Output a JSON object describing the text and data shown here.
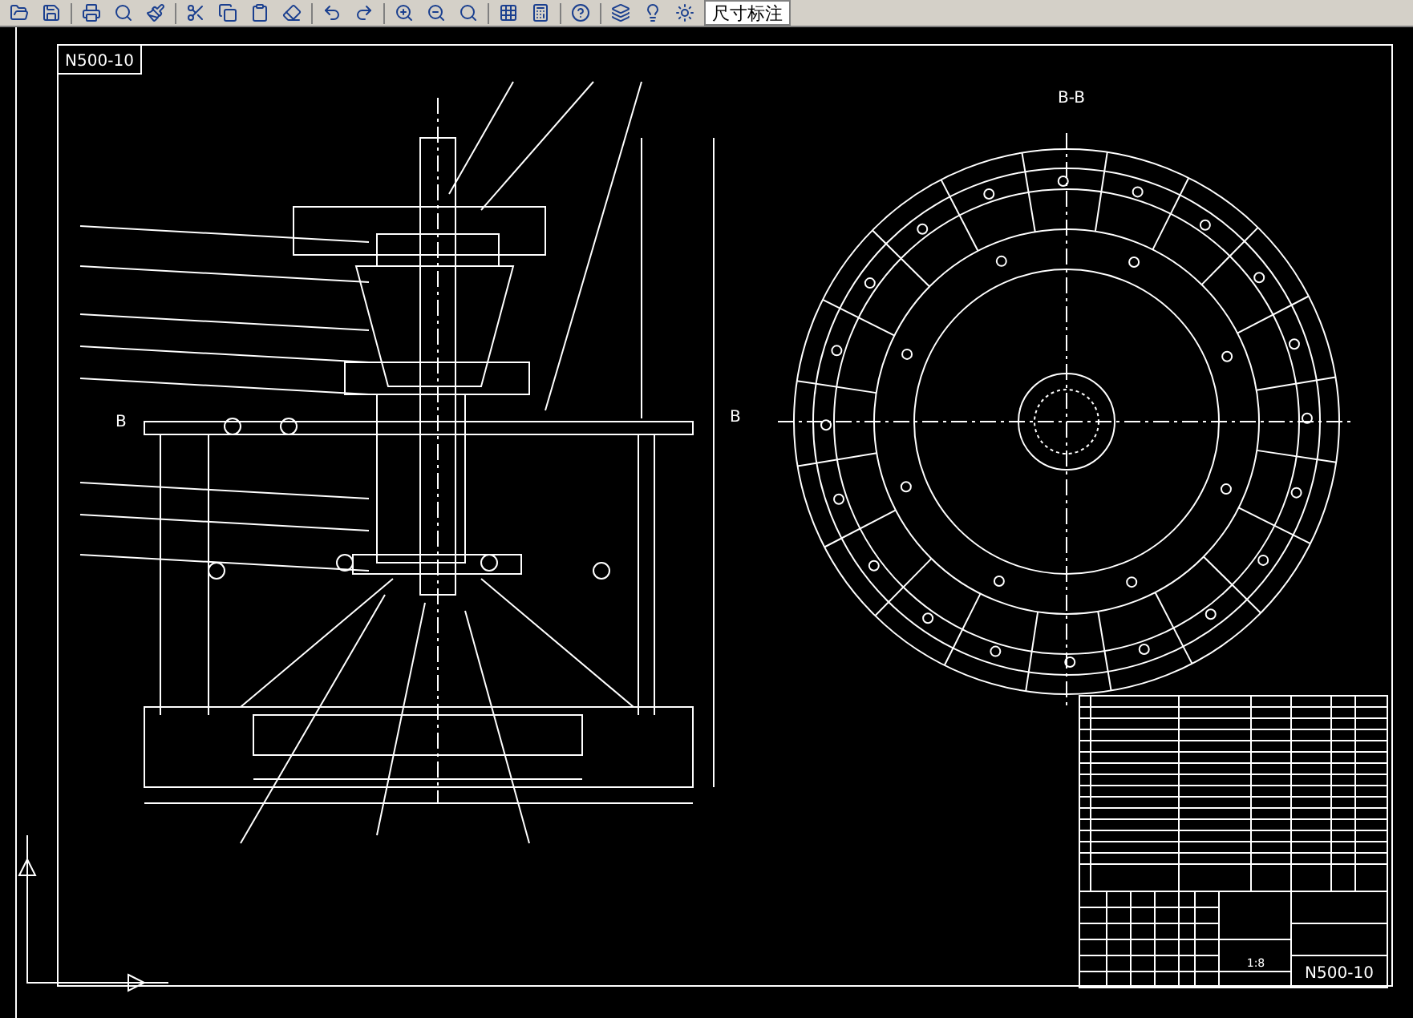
{
  "toolbar": {
    "layer_name": "尺寸标注"
  },
  "drawing": {
    "frame_label": "N500-10",
    "section_title": "B-B",
    "section_marks": [
      "B",
      "B"
    ]
  },
  "title_block": {
    "scale": "1:8",
    "drawing_number": "N500-10"
  }
}
